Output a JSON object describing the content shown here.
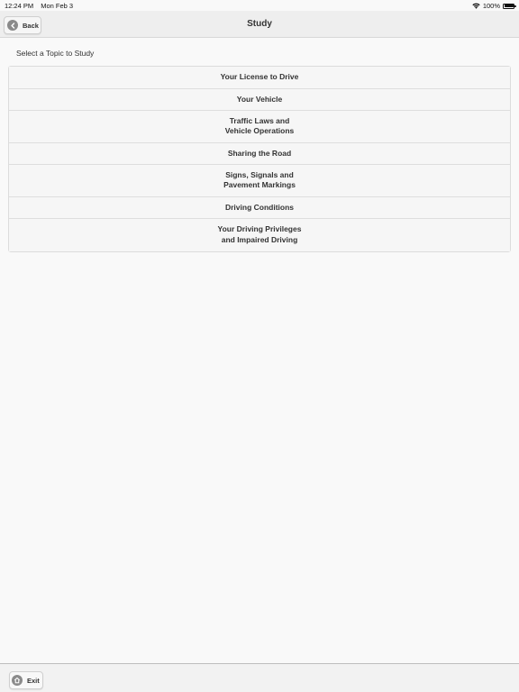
{
  "status_bar": {
    "time": "12:24 PM",
    "date": "Mon Feb 3",
    "battery_text": "100%",
    "icons": [
      "wifi-icon",
      "battery-icon"
    ]
  },
  "header": {
    "title": "Study",
    "back_label": "Back",
    "back_icon": "chevron-left-icon"
  },
  "subtitle": "Select a Topic to Study",
  "topics": [
    {
      "label": "Your License to Drive"
    },
    {
      "label": "Your Vehicle"
    },
    {
      "label": "Traffic Laws and\nVehicle Operations"
    },
    {
      "label": "Sharing the Road"
    },
    {
      "label": "Signs, Signals and\nPavement Markings"
    },
    {
      "label": "Driving Conditions"
    },
    {
      "label": "Your Driving Privileges\nand Impaired Driving"
    }
  ],
  "footer": {
    "exit_label": "Exit",
    "exit_icon": "home-icon"
  },
  "colors": {
    "background": "#f9f9f9",
    "header_bg": "#eeeeee",
    "icon_circle": "#8a8a8a",
    "text": "#333333"
  }
}
